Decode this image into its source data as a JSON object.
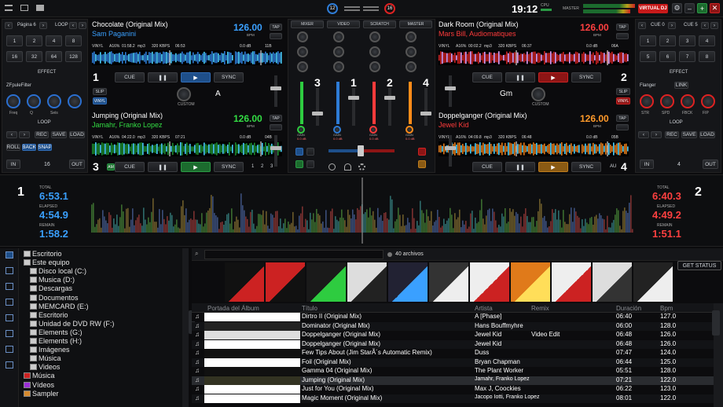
{
  "topbar": {
    "time": "19:12",
    "cpu_label": "CPU",
    "master_label": "MASTER",
    "brand": "VIRTUAL DJ",
    "deck_left_num": "12",
    "deck_right_num": "16"
  },
  "left_sampler": {
    "page_label": "Página 6",
    "loop_label": "LOOP",
    "loop_values": [
      "1",
      "2",
      "4",
      "8",
      "16",
      "32",
      "64",
      "128"
    ],
    "effect_label": "EFFECT",
    "effect_name": "ZFpuleFilter",
    "knob_labels": [
      "Freq",
      "Q",
      "Seis",
      ""
    ],
    "loop_label2": "LOOP",
    "roll": "ROLL",
    "back": "BACK",
    "snap": "SNAP",
    "in": "IN",
    "out": "OUT",
    "loop_size": "16",
    "rec": "REC",
    "save": "SAVE",
    "load": "LOAD"
  },
  "right_sampler": {
    "cue_labels": [
      "CUE 0",
      "CUE 5"
    ],
    "cue_values": [
      "1",
      "2",
      "3",
      "4",
      "5",
      "6",
      "7",
      "8"
    ],
    "effect_label": "EFFECT",
    "effect_name": "Flanger",
    "link": "LINK",
    "knob_labels": [
      "STR",
      "SPD",
      "FBCK",
      "FIP"
    ],
    "loop_label": "LOOP",
    "rec": "REC",
    "save": "SAVE",
    "load": "LOAD",
    "in": "IN",
    "out": "OUT",
    "loop_size": "4"
  },
  "deck1": {
    "num": "1",
    "title": "Chocolate (Original Mix)",
    "artist": "Sam Paganini",
    "bpm": "126.00",
    "bpm_label": "BPM",
    "tap": "TAP",
    "info": [
      "VINYL",
      "A16%",
      "01:58.2",
      "mp3",
      "320 KBPS",
      "06:53"
    ],
    "gain": "0.0 dB",
    "key": "11B",
    "cue": "CUE",
    "play": "▶",
    "sync": "SYNC",
    "custom": "CUSTOM",
    "key_letter": "A",
    "slip": "SLIP",
    "vinyl": "VINYL"
  },
  "deck2": {
    "num": "2",
    "title": "Dark Room (Original Mix)",
    "artist": "Mars Bill, Audiomatiques",
    "bpm": "126.00",
    "bpm_label": "BPM",
    "tap": "TAP",
    "info": [
      "VINYL",
      "A16%",
      "00:02.2",
      "mp3",
      "320 KBPS",
      "06:37"
    ],
    "gain": "0.0 dB",
    "key": "06A",
    "cue": "CUE",
    "play": "▶",
    "sync": "SYNC",
    "custom": "CUSTOM",
    "key_letter": "Gm",
    "slip": "SLIP",
    "vinyl": "VINYL"
  },
  "deck3": {
    "num": "3",
    "title": "Jumping (Original Mix)",
    "artist": "Jamahr, Franko Lopez",
    "bpm": "126.00",
    "bpm_label": "BPM",
    "tap": "TAP",
    "info": [
      "VINYL",
      "A16%",
      "04:22.0",
      "mp3",
      "320 KBPS",
      "07:21"
    ],
    "gain": "0.0 dB",
    "key": "04B",
    "cue": "CUE",
    "play": "▶",
    "sync": "SYNC",
    "am": "AM",
    "pages": [
      "1",
      "2",
      "3"
    ]
  },
  "deck4": {
    "num": "4",
    "title": "Doppelganger (Original Mix)",
    "artist": "Jewel Kid",
    "bpm": "126.00",
    "bpm_label": "BPM",
    "tap": "TAP",
    "info": [
      "VINYL",
      "A16%",
      "04:09.8",
      "mp3",
      "320 KBPS",
      "06:48"
    ],
    "gain": "0.0 dB",
    "key": "05B",
    "cue": "CUE",
    "play": "▶",
    "sync": "SYNC",
    "au": "AU"
  },
  "mixer": {
    "tabs": [
      "MIXER",
      "VIDEO",
      "SCRATCH",
      "MASTER"
    ],
    "channels": [
      "3",
      "1",
      "2",
      "4"
    ],
    "gain_label": "GAIN",
    "gain_value": "0.0 dB"
  },
  "timers": {
    "left": {
      "num": "1",
      "total_label": "TOTAL",
      "total": "6:53.1",
      "elapsed_label": "ELAPSED",
      "elapsed": "4:54.9",
      "remain_label": "REMAIN",
      "remain": "1:58.2"
    },
    "right": {
      "num": "2",
      "total_label": "TOTAL",
      "total": "6:40.3",
      "elapsed_label": "ELAPSED",
      "elapsed": "4:49.2",
      "remain_label": "REMAIN",
      "remain": "1:51.1"
    }
  },
  "browser": {
    "folders": [
      "Escritorio",
      "Este equipo",
      "Disco local (C:)",
      "Musica (D:)",
      "Descargas",
      "Documentos",
      "MEMCARD (E:)",
      "Escritorio",
      "Unidad de DVD RW (F:)",
      "Elements (G:)",
      "Elements (H:)",
      "Imágenes",
      "Música",
      "Videos",
      "Música",
      "Vídeos",
      "Sampler"
    ],
    "file_count": "40 archivos",
    "get_status": "GET STATUS",
    "columns": [
      "Portada del Álbum",
      "Título",
      "Artista",
      "Remix",
      "Duración",
      "Bpm"
    ],
    "side_tab": "folders",
    "right_tab": "sidelist"
  },
  "tracks": [
    {
      "title": "Dirtro II (Original Mix)",
      "artist": "A [Phase]",
      "remix": "",
      "duration": "06:40",
      "bpm": "127.0"
    },
    {
      "title": "Dominator (Original Mix)",
      "artist": "Hans Bouffmyhre",
      "remix": "",
      "duration": "06:00",
      "bpm": "128.0"
    },
    {
      "title": "Doppelganger (Original Mix)",
      "artist": "Jewel Kid",
      "remix": "Video Edit",
      "duration": "06:48",
      "bpm": "126.0"
    },
    {
      "title": "Doppelganger (Original Mix)",
      "artist": "Jewel Kid",
      "remix": "",
      "duration": "06:48",
      "bpm": "126.0"
    },
    {
      "title": "Few Tips About (Jim StarÃ´s Automatic Remix)",
      "artist": "Duss",
      "remix": "",
      "duration": "07:47",
      "bpm": "124.0"
    },
    {
      "title": "Foil (Original Mix)",
      "artist": "Bryan Chapman",
      "remix": "",
      "duration": "06:44",
      "bpm": "125.0"
    },
    {
      "title": "Gamma 04 (Original Mix)",
      "artist": "The Plant Worker",
      "remix": "",
      "duration": "05:51",
      "bpm": "128.0"
    },
    {
      "title": "Jumping (Original Mix)",
      "artist": "Jamahr, Franko Lopez",
      "remix": "",
      "duration": "07:21",
      "bpm": "122.0"
    },
    {
      "title": "Just for You (Original Mix)",
      "artist": "Max J, Coockies",
      "remix": "",
      "duration": "06:22",
      "bpm": "123.0"
    },
    {
      "title": "Magic Moment (Original Mix)",
      "artist": "Jacopo Iotti, Franko Lopez",
      "remix": "",
      "duration": "08:01",
      "bpm": "122.0"
    }
  ],
  "colors": {
    "accent": "#2e7cd6",
    "deck1": "#ffffff",
    "deck2": "#ff3b3b",
    "deck3": "#2ecc40",
    "deck4": "#ff8c1a",
    "bpm_blue": "#3aa0ff",
    "bpm_red": "#ff4040",
    "bpm_green": "#33dd44",
    "bpm_orange": "#ff9a2a"
  }
}
